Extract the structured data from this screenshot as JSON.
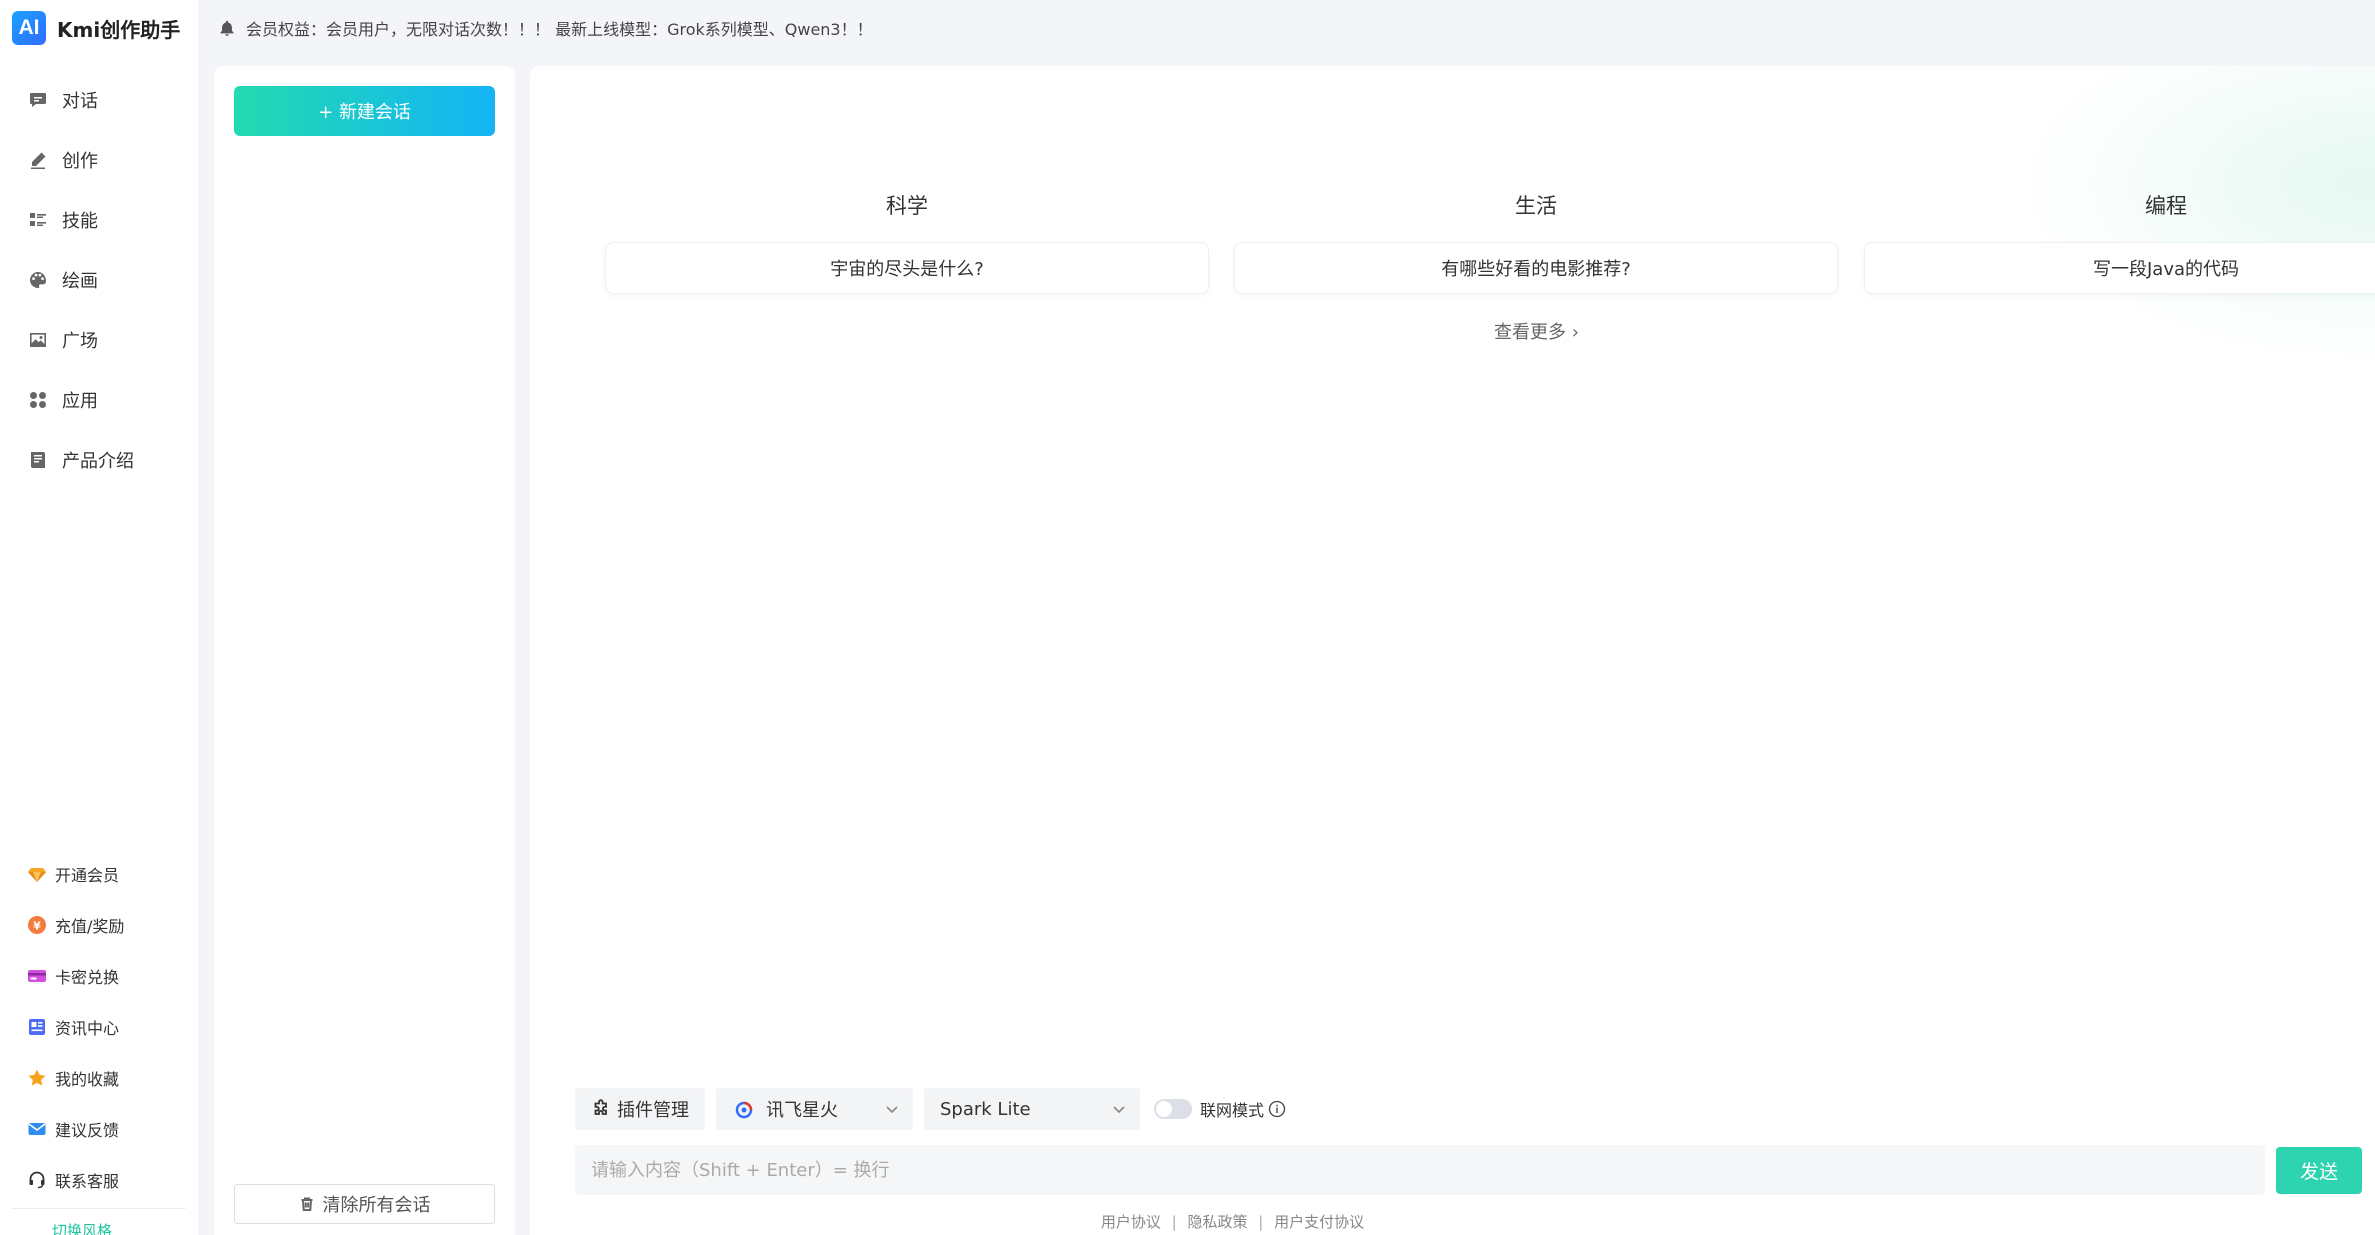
{
  "brand": {
    "logo_text": "AI",
    "name": "Kmi创作助手"
  },
  "notice": {
    "text": "会员权益：会员用户，无限对话次数！！！ 最新上线模型：Grok系列模型、Qwen3！！"
  },
  "nav": {
    "items": [
      {
        "label": "对话",
        "icon": "chat-icon"
      },
      {
        "label": "创作",
        "icon": "pen-icon"
      },
      {
        "label": "技能",
        "icon": "list-icon"
      },
      {
        "label": "绘画",
        "icon": "palette-icon"
      },
      {
        "label": "广场",
        "icon": "image-icon"
      },
      {
        "label": "应用",
        "icon": "apps-icon"
      },
      {
        "label": "产品介绍",
        "icon": "book-icon"
      }
    ],
    "bottom": [
      {
        "label": "开通会员",
        "icon": "diamond-icon"
      },
      {
        "label": "充值/奖励",
        "icon": "coin-icon"
      },
      {
        "label": "卡密兑换",
        "icon": "card-icon"
      },
      {
        "label": "资讯中心",
        "icon": "news-icon"
      },
      {
        "label": "我的收藏",
        "icon": "star-icon"
      },
      {
        "label": "建议反馈",
        "icon": "mail-icon"
      },
      {
        "label": "联系客服",
        "icon": "headset-icon"
      }
    ],
    "switch_label": "切换风格"
  },
  "conversations": {
    "new_chat_label": "+ 新建会话",
    "clear_all_label": "清除所有会话"
  },
  "main": {
    "categories": [
      {
        "title": "科学",
        "prompt": "宇宙的尽头是什么?"
      },
      {
        "title": "生活",
        "prompt": "有哪些好看的电影推荐?"
      },
      {
        "title": "编程",
        "prompt": "写一段Java的代码"
      }
    ],
    "see_more": "查看更多"
  },
  "composer": {
    "plugin_label": "插件管理",
    "provider": "讯飞星火",
    "model": "Spark Lite",
    "web_mode_label": "联网模式",
    "web_mode_on": false,
    "placeholder": "请输入内容（Shift + Enter）= 换行",
    "send_label": "发送"
  },
  "footer": {
    "links": [
      "用户协议",
      "隐私政策",
      "用户支付协议"
    ],
    "separator": "|"
  },
  "colors": {
    "accent": "#2ed3b0",
    "gradient_start": "#22dbb0",
    "gradient_end": "#14b4f5"
  }
}
